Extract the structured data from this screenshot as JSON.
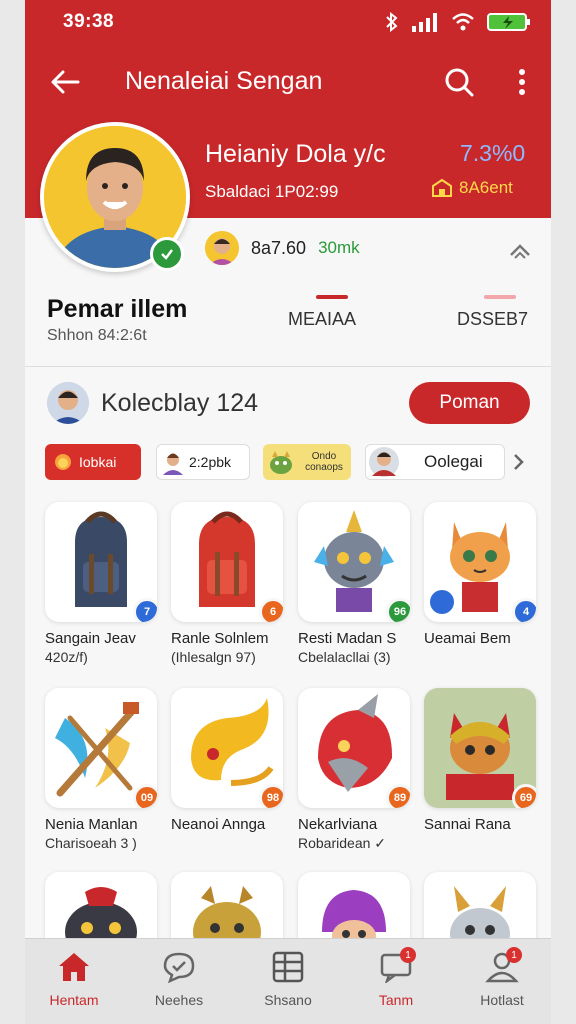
{
  "status_bar": {
    "time": "39:38"
  },
  "app_bar": {
    "title": "Nenaleiai Sengan"
  },
  "profile": {
    "name": "Heianiy Dola y/c",
    "rate": "7.3%0",
    "id_text": "Sbaldaci 1P02:99",
    "balance": "8A6ent",
    "stat_value": "8a7.60",
    "stat_unit": "30mk"
  },
  "tabs": {
    "title": "Pemar illem",
    "subtitle": "Shhon 84:2:6t",
    "items": [
      {
        "label": "MEAIAA",
        "indicator": "#c9282b"
      },
      {
        "label": "DSSEB7",
        "indicator": "#f2a7aa"
      }
    ]
  },
  "collection": {
    "title": "Kolecblay 124",
    "button": "Poman"
  },
  "chips": [
    {
      "label": "Iobkai"
    },
    {
      "label": "2:2pbk"
    },
    {
      "label": "Ondo conaops"
    },
    {
      "label": "Oolegai"
    }
  ],
  "items": [
    {
      "title": "Sangain Jeav",
      "subtitle": "420z/f)",
      "badge": "7",
      "badge_color": "#2e6bd8",
      "icon": "backpack-blue-icon"
    },
    {
      "title": "Ranle Solnlem",
      "subtitle": "(Ihlesalgn 97)",
      "badge": "6",
      "badge_color": "#e8661e",
      "icon": "backpack-red-icon"
    },
    {
      "title": "Resti Madan S",
      "subtitle": "Cbelalacllai (3)",
      "badge": "96",
      "badge_color": "#2c9a3c",
      "icon": "dragon-creature-icon"
    },
    {
      "title": "Ueamai Bem",
      "subtitle": "",
      "badge": "4",
      "badge_color": "#2e6bd8",
      "icon": "fox-creature-icon"
    },
    {
      "title": "Nenia Manlan",
      "subtitle": "Charisoeah 3 )",
      "badge": "09",
      "badge_color": "#e8661e",
      "icon": "crossed-tools-icon"
    },
    {
      "title": "Neanoi Annga",
      "subtitle": "",
      "badge": "98",
      "badge_color": "#e8661e",
      "icon": "golden-horn-icon"
    },
    {
      "title": "Nekarlviana",
      "subtitle": "Robaridean ✓",
      "badge": "89",
      "badge_color": "#e8661e",
      "icon": "red-helmet-icon"
    },
    {
      "title": "Sannai Rana",
      "subtitle": "",
      "badge": "69",
      "badge_color": "#e8661e",
      "icon": "warrior-cat-icon"
    }
  ],
  "bottom_nav": [
    {
      "label": "Hentam",
      "icon": "home-icon",
      "active": true
    },
    {
      "label": "Neehes",
      "icon": "chat-icon",
      "active": false
    },
    {
      "label": "Shsano",
      "icon": "grid-icon",
      "active": false
    },
    {
      "label": "Tanm",
      "icon": "message-icon",
      "active": false,
      "badge": "1"
    },
    {
      "label": "Hotlast",
      "icon": "profile-icon",
      "active": false,
      "badge": "1"
    }
  ],
  "colors": {
    "primary": "#c9282b",
    "accent_green": "#2c9a3c",
    "accent_gold": "#ffd84a"
  }
}
